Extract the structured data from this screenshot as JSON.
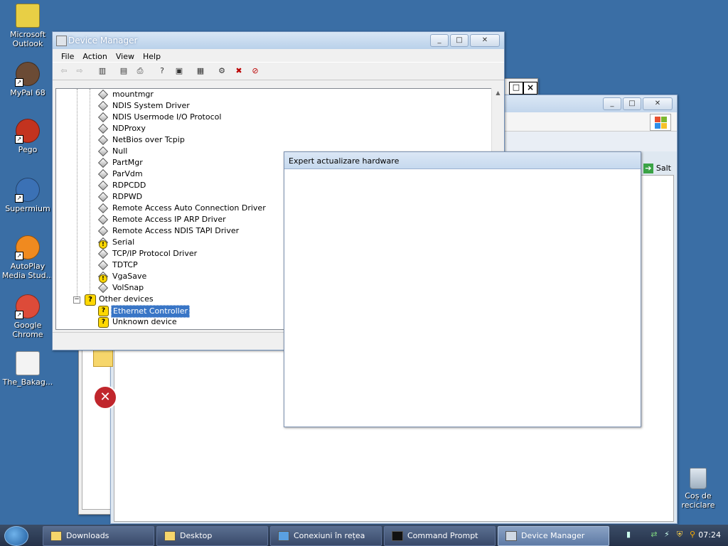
{
  "desktop": {
    "icons": [
      {
        "label": "Microsoft\nOutlook",
        "icon": "outlook-icon"
      },
      {
        "label": "MyPal 68",
        "icon": "mypal-icon"
      },
      {
        "label": "Pego",
        "icon": "pego-icon"
      },
      {
        "label": "Supermium",
        "icon": "supermium-icon"
      },
      {
        "label": "AutoPlay\nMedia Stud...",
        "icon": "autoplay-icon"
      },
      {
        "label": "Google\nChrome",
        "icon": "chrome-icon"
      },
      {
        "label": "The_Bakag...",
        "icon": "document-icon"
      }
    ],
    "recycle_bin": "Coș de\nreciclare"
  },
  "device_manager": {
    "title": "Device Manager",
    "menu": [
      "File",
      "Action",
      "View",
      "Help"
    ],
    "drivers": [
      {
        "label": "mountmgr",
        "warn": false
      },
      {
        "label": "NDIS System Driver",
        "warn": false
      },
      {
        "label": "NDIS Usermode I/O Protocol",
        "warn": false
      },
      {
        "label": "NDProxy",
        "warn": false
      },
      {
        "label": "NetBios over Tcpip",
        "warn": false
      },
      {
        "label": "Null",
        "warn": false
      },
      {
        "label": "PartMgr",
        "warn": false
      },
      {
        "label": "ParVdm",
        "warn": false
      },
      {
        "label": "RDPCDD",
        "warn": false
      },
      {
        "label": "RDPWD",
        "warn": false
      },
      {
        "label": "Remote Access Auto Connection Driver",
        "warn": false
      },
      {
        "label": "Remote Access IP ARP Driver",
        "warn": false
      },
      {
        "label": "Remote Access NDIS TAPI Driver",
        "warn": false
      },
      {
        "label": "Serial",
        "warn": true
      },
      {
        "label": "TCP/IP Protocol Driver",
        "warn": false
      },
      {
        "label": "TDTCP",
        "warn": false
      },
      {
        "label": "VgaSave",
        "warn": true
      },
      {
        "label": "VolSnap",
        "warn": false
      }
    ],
    "other_devices_label": "Other devices",
    "other_devices": [
      {
        "label": "Ethernet Controller",
        "selected": true
      },
      {
        "label": "Unknown device",
        "selected": false
      }
    ]
  },
  "background_window": {
    "go_label": "Salt"
  },
  "expert": {
    "title": "Expert actualizare hardware"
  },
  "taskbar": {
    "buttons": [
      {
        "label": "Downloads",
        "active": false
      },
      {
        "label": "Desktop",
        "active": false
      },
      {
        "label": "Conexiuni în rețea",
        "active": false
      },
      {
        "label": "Command Prompt",
        "active": false
      },
      {
        "label": "Device Manager",
        "active": true
      }
    ],
    "clock": "07:24"
  }
}
